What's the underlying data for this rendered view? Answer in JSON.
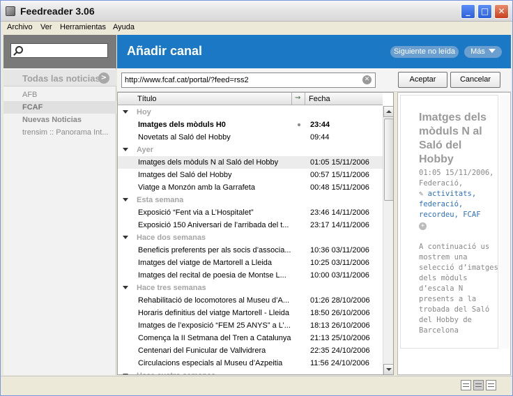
{
  "window": {
    "title": "Feedreader 3.06",
    "minimize": "_",
    "maximize": "□",
    "close": "✕"
  },
  "menu": [
    "Archivo",
    "Ver",
    "Herramientas",
    "Ayuda"
  ],
  "sidebar": {
    "search": {
      "value": "",
      "icon": "search-icon"
    },
    "all_news": "Todas las noticias",
    "all_news_btn": ">",
    "feeds": [
      {
        "label": "AFB",
        "state": "normal"
      },
      {
        "label": "FCAF",
        "state": "selected"
      },
      {
        "label": "Nuevas Noticias",
        "state": "bold"
      },
      {
        "label": "trensim :: Panorama Int...",
        "state": "normal"
      }
    ]
  },
  "header": {
    "title": "Añadir canal",
    "next_unread": "Siguiente no leída",
    "more": "Más"
  },
  "url_bar": {
    "value": "http://www.fcaf.cat/portal/?feed=rss2",
    "accept": "Aceptar",
    "cancel": "Cancelar"
  },
  "list": {
    "columns": {
      "title": "Título",
      "flag": "⇝",
      "date": "Fecha"
    },
    "rows": [
      {
        "type": "group",
        "label": "Hoy"
      },
      {
        "type": "item",
        "title": "Imatges dels mòduls H0",
        "date": "23:44",
        "unread": true,
        "dot": true
      },
      {
        "type": "item",
        "title": "Novetats al Saló del Hobby",
        "date": "09:44"
      },
      {
        "type": "group",
        "label": "Ayer"
      },
      {
        "type": "item",
        "title": "Imatges dels mòduls N al Saló del Hobby",
        "date": "01:05 15/11/2006",
        "selected": true
      },
      {
        "type": "item",
        "title": "Imatges del Saló del Hobby",
        "date": "00:57 15/11/2006"
      },
      {
        "type": "item",
        "title": "Viatge a Monzón amb la Garrafeta",
        "date": "00:48 15/11/2006"
      },
      {
        "type": "group",
        "label": "Esta semana"
      },
      {
        "type": "item",
        "title": "Exposició “Fent via a L’Hospitalet”",
        "date": "23:46 14/11/2006"
      },
      {
        "type": "item",
        "title": "Exposició 150 Aniversari de l’arribada del t...",
        "date": "23:17 14/11/2006"
      },
      {
        "type": "group",
        "label": "Hace dos semanas"
      },
      {
        "type": "item",
        "title": "Beneficis preferents per als socis d’associa...",
        "date": "10:36 03/11/2006"
      },
      {
        "type": "item",
        "title": "Imatges del viatge de Martorell a Lleida",
        "date": "10:25 03/11/2006"
      },
      {
        "type": "item",
        "title": "Imatges del recital de poesia de Montse L...",
        "date": "10:00 03/11/2006"
      },
      {
        "type": "group",
        "label": "Hace tres semanas"
      },
      {
        "type": "item",
        "title": "Rehabilitació de locomotores al Museu d’A...",
        "date": "01:26 28/10/2006"
      },
      {
        "type": "item",
        "title": "Horaris definitius del viatge Martorell - Lleida",
        "date": "18:50 26/10/2006"
      },
      {
        "type": "item",
        "title": "Imatges de l’exposició “FEM 25 ANYS” a L’...",
        "date": "18:13 26/10/2006"
      },
      {
        "type": "item",
        "title": "Comença la II Setmana del Tren a Catalunya",
        "date": "21:13 25/10/2006"
      },
      {
        "type": "item",
        "title": "Centenari del Funicular de Vallvidrera",
        "date": "22:35 24/10/2006"
      },
      {
        "type": "item",
        "title": "Circulacions especials al Museu d’Azpeitia",
        "date": "11:56 24/10/2006"
      },
      {
        "type": "group",
        "label": "Hace cuatro semanas"
      }
    ]
  },
  "preview": {
    "title": "Imatges dels mòduls N al Saló del Hobby",
    "meta_date": "01:05 15/11/2006,",
    "meta_author": "Federació,",
    "tags": [
      "activitats,",
      "federació,",
      "recordeu,",
      "FCAF"
    ],
    "body": "A continuació us mostrem una selecció d’imatges dels mòduls d’escala N presents a la trobada del Saló del Hobby de Barcelona"
  },
  "status_bar": {
    "view_modes": [
      "layout-icon-1",
      "layout-icon-2",
      "layout-icon-3"
    ]
  }
}
